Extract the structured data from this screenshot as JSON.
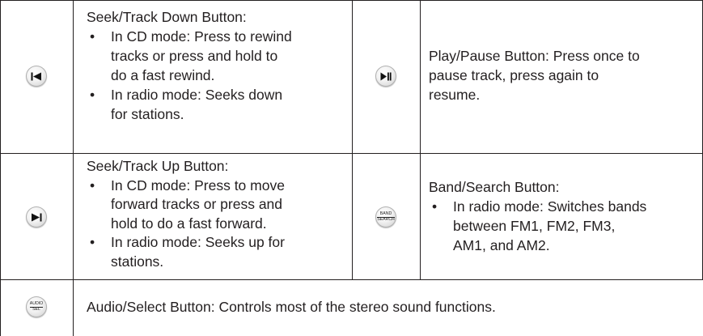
{
  "rows": [
    {
      "left": {
        "icon": "seek-track-down-icon",
        "title": "Seek/Track Down Button:",
        "bullets": [
          [
            "In CD mode: Press to rewind",
            "tracks or press and hold to",
            "do a fast rewind."
          ],
          [
            "In radio mode: Seeks down",
            "for stations."
          ]
        ]
      },
      "right": {
        "icon": "play-pause-icon",
        "lines": [
          "Play/Pause Button: Press once to",
          "pause track, press again to",
          "resume."
        ]
      }
    },
    {
      "left": {
        "icon": "seek-track-up-icon",
        "title": "Seek/Track Up Button:",
        "bullets": [
          [
            "In CD mode: Press to move",
            "forward tracks or press and",
            "hold to do a fast forward."
          ],
          [
            "In radio mode: Seeks up for",
            "stations."
          ]
        ]
      },
      "right": {
        "icon": "band-search-icon",
        "icon_text_top": "BAND",
        "icon_text_bottom": "SEARCH",
        "title": "Band/Search Button:",
        "bullets": [
          [
            "In radio mode: Switches bands",
            "between FM1, FM2, FM3,",
            "AM1, and AM2."
          ]
        ]
      }
    },
    {
      "full": {
        "icon": "audio-select-icon",
        "icon_text_top": "AUDIO",
        "icon_text_bottom": "SEL",
        "text": "Audio/Select Button: Controls most of the stereo sound functions."
      }
    }
  ],
  "bullet_char": "•"
}
